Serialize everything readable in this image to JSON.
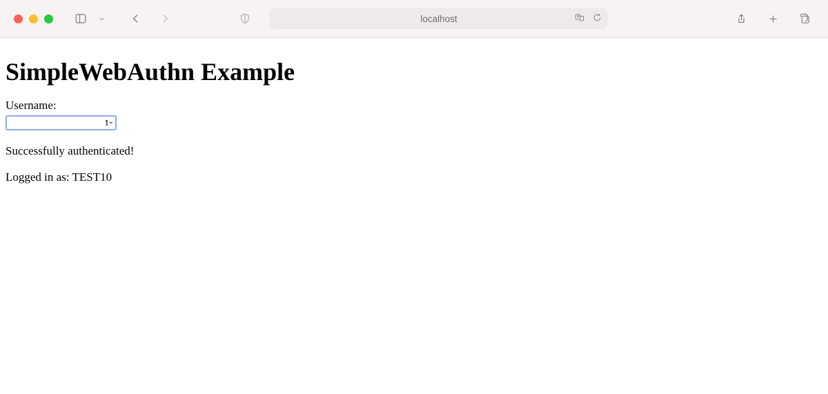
{
  "browser": {
    "address": "localhost"
  },
  "page": {
    "heading": "SimpleWebAuthn Example",
    "username_label": "Username:",
    "username_value": "",
    "status_message": "Successfully authenticated!",
    "logged_in_prefix": "Logged in as: ",
    "logged_in_user": "TEST10"
  }
}
